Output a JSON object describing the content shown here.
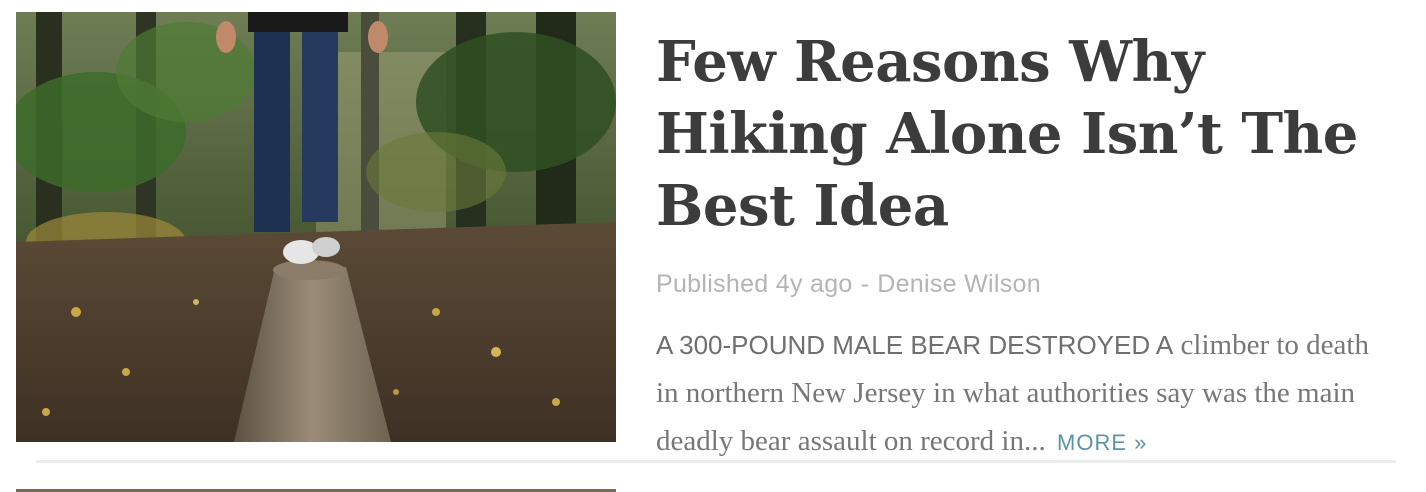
{
  "article": {
    "title": "Few Reasons Why Hiking Alone Isn’t The Best Idea",
    "meta": {
      "published": "Published 4y ago",
      "separator": "-",
      "author": "Denise Wilson"
    },
    "excerpt": {
      "lead": "A 300-POUND MALE BEAR DESTROYED A",
      "body": " climber to death in northern New Jersey in what authorities say was the main deadly bear assault on record in...",
      "more": "MORE »"
    }
  }
}
